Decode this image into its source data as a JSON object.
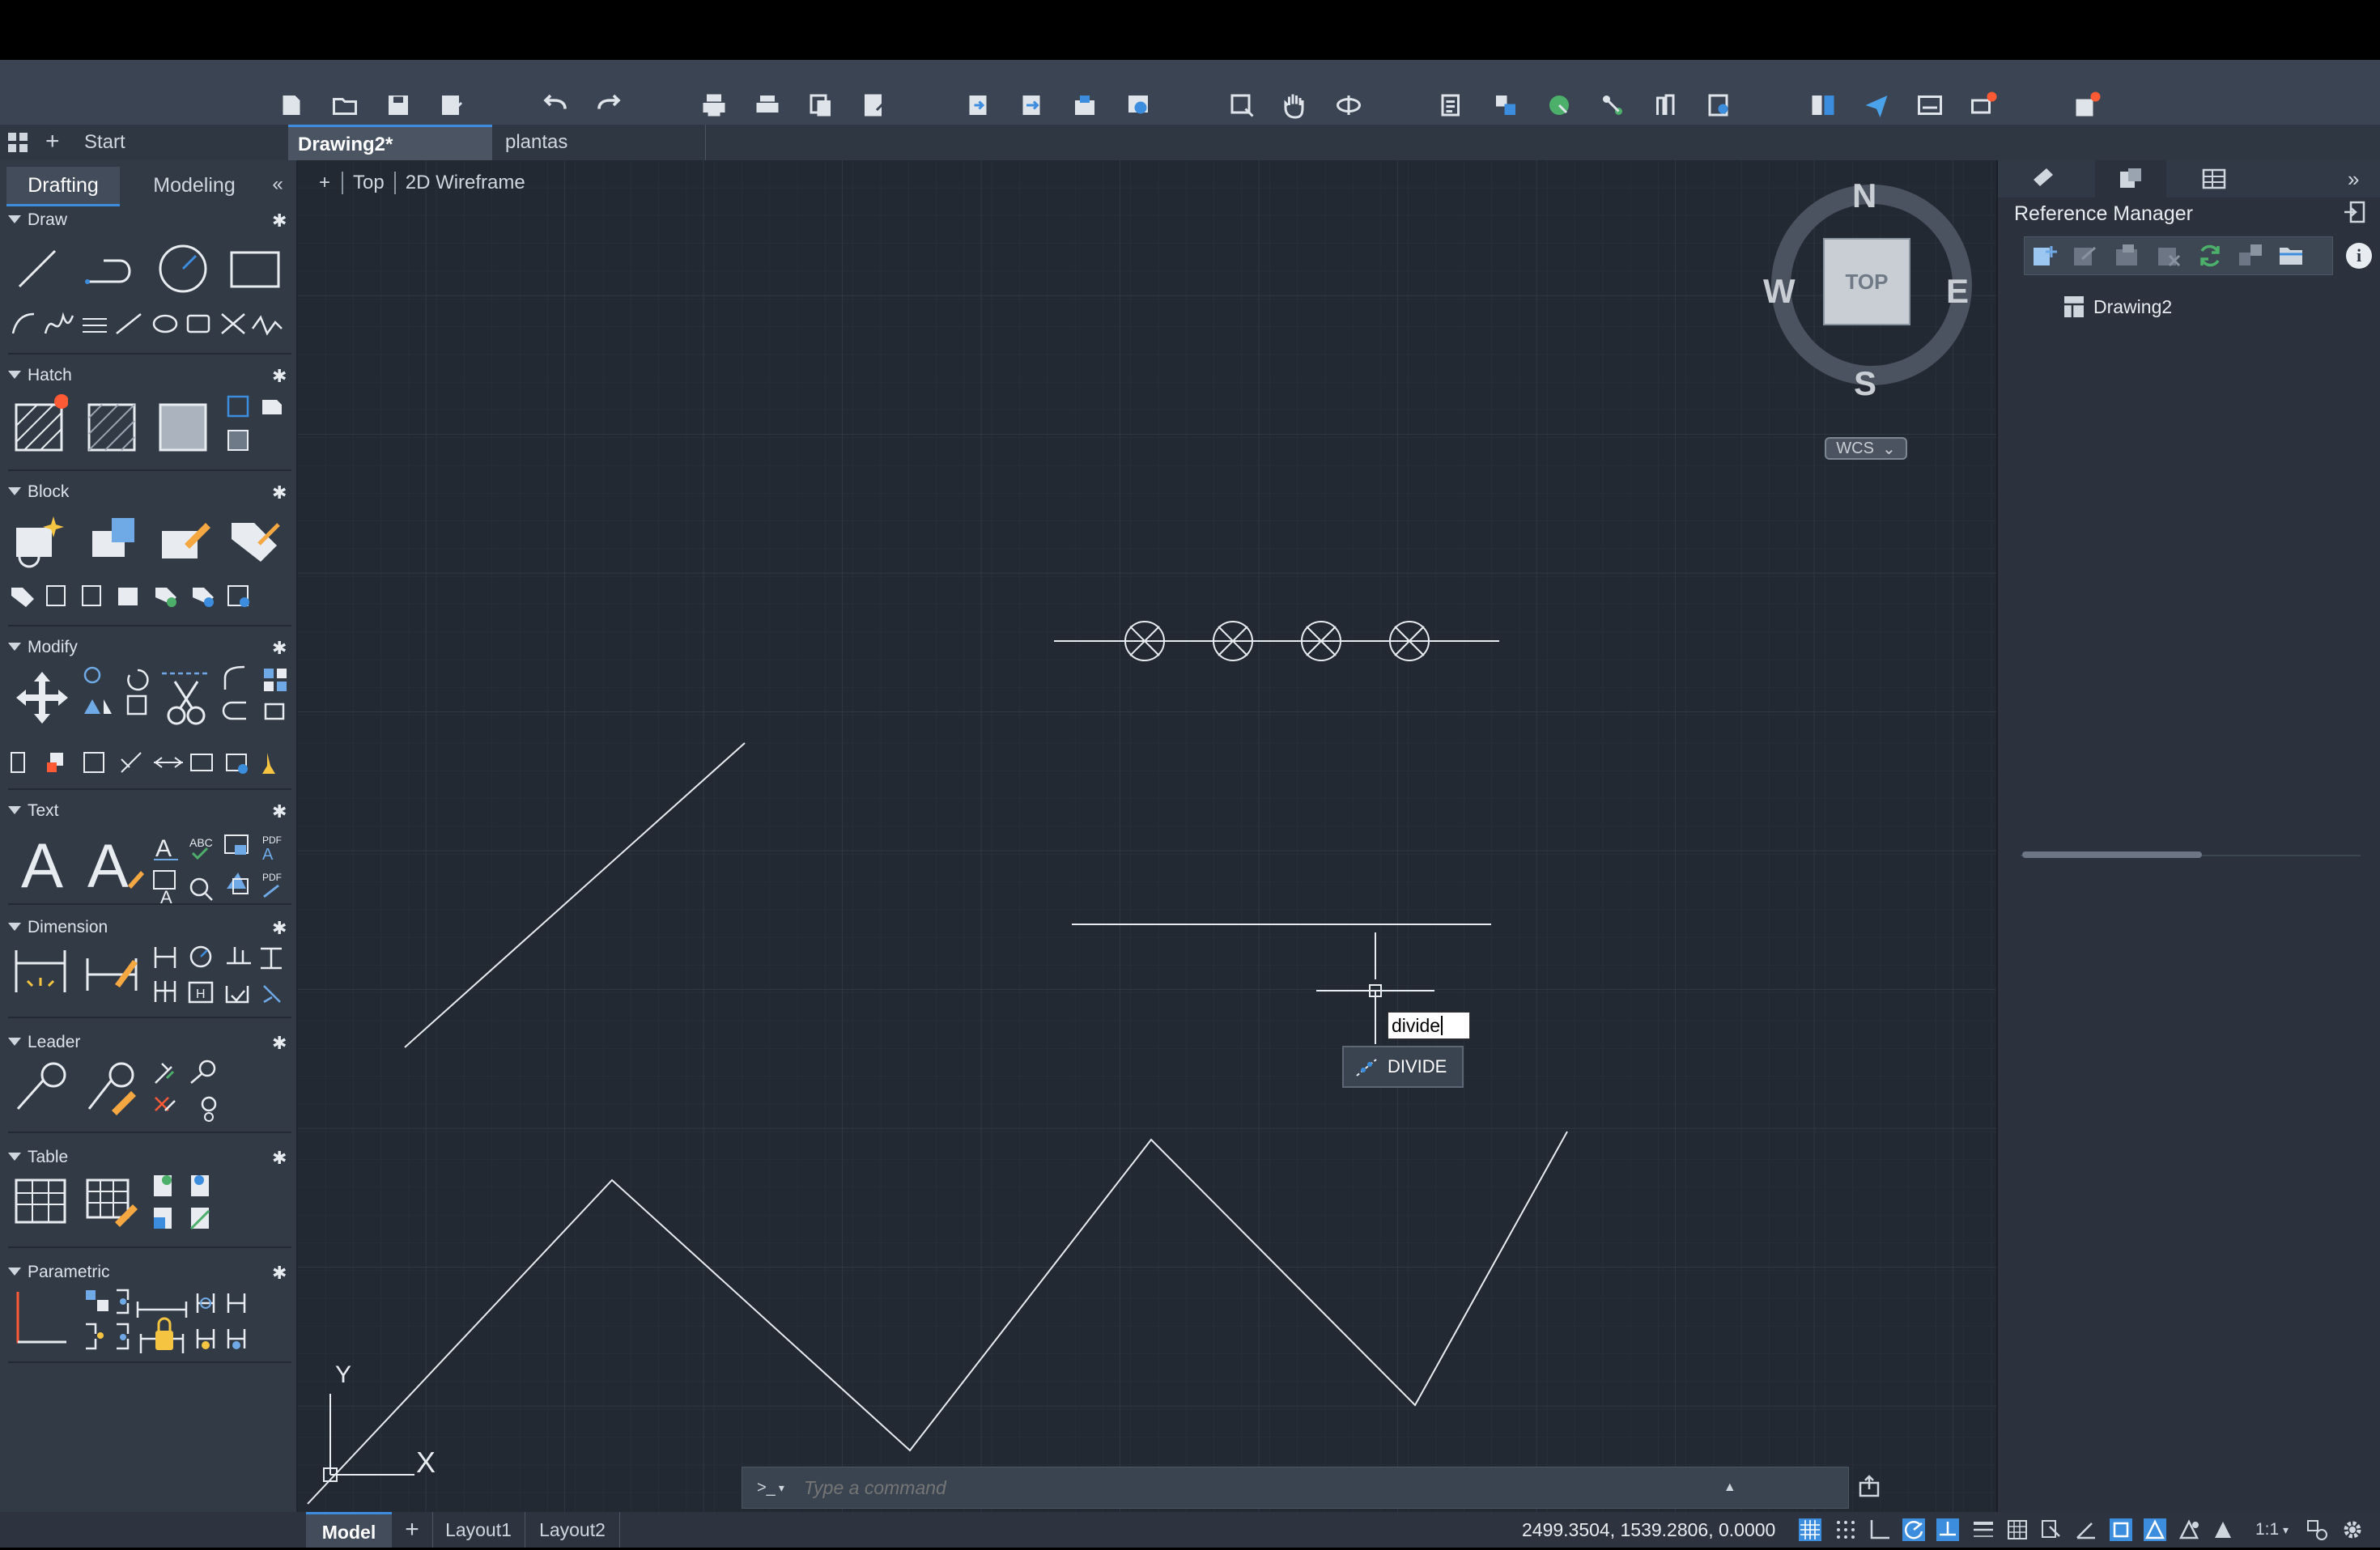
{
  "tabs": {
    "start": "Start",
    "active": "Drawing2*",
    "other": "plantas"
  },
  "workspace_tabs": [
    "Drafting",
    "Modeling"
  ],
  "collapse_label": "«",
  "sections": {
    "draw": "Draw",
    "hatch": "Hatch",
    "block": "Block",
    "modify": "Modify",
    "text": "Text",
    "dimension": "Dimension",
    "leader": "Leader",
    "table": "Table",
    "parametric": "Parametric"
  },
  "viewport": {
    "plus": "+",
    "view": "Top",
    "style": "2D Wireframe"
  },
  "viewcube": {
    "north": "N",
    "south": "S",
    "east": "E",
    "west": "W",
    "face": "TOP",
    "ucs": "WCS"
  },
  "ucs_icon": {
    "x": "X",
    "y": "Y"
  },
  "dynamic_input": {
    "value": "divide",
    "suggestion": "DIVIDE"
  },
  "command_line": {
    "prompt": ">_",
    "placeholder": "Type a command"
  },
  "reference_manager": {
    "title": "Reference Manager",
    "root": "Drawing2",
    "expand": "»"
  },
  "layouts": [
    "Model",
    "Layout1",
    "Layout2"
  ],
  "status": {
    "coords": "2499.3504, 1539.2806, 0.0000",
    "scale": "1:1"
  },
  "colors": {
    "accent": "#3c8dde",
    "canvas": "#222933",
    "notification": "#ff5a36"
  }
}
